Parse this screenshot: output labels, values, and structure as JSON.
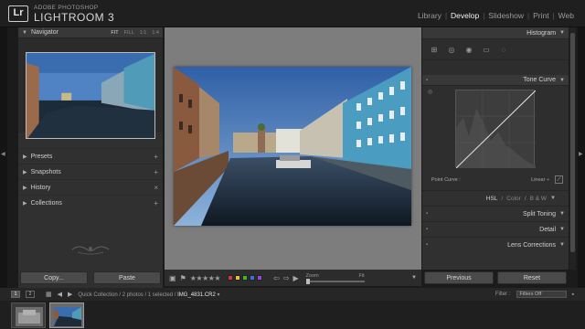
{
  "app": {
    "brand_small": "ADOBE PHOTOSHOP",
    "brand_main": "LIGHTROOM 3",
    "logo": "Lr"
  },
  "modules": [
    {
      "label": "Library"
    },
    {
      "label": "Develop",
      "active": true
    },
    {
      "label": "Slideshow"
    },
    {
      "label": "Print"
    },
    {
      "label": "Web"
    }
  ],
  "navigator": {
    "title": "Navigator",
    "options": [
      "FIT",
      "FILL",
      "1:1",
      "1:4"
    ]
  },
  "left_sections": [
    {
      "label": "Presets",
      "action": "+"
    },
    {
      "label": "Snapshots",
      "action": "+"
    },
    {
      "label": "History",
      "action": "×"
    },
    {
      "label": "Collections",
      "action": "+"
    }
  ],
  "left_buttons": {
    "copy": "Copy...",
    "paste": "Paste"
  },
  "toolbar": {
    "stars": "★★★★★",
    "color_labels": [
      "#d23a3a",
      "#e3c235",
      "#47b043",
      "#3d6fd8",
      "#8e4fc6"
    ],
    "zoom_label": "Zoom",
    "fit_label": "Fit"
  },
  "right_panel": {
    "histogram": "Histogram",
    "tone_curve": "Tone Curve",
    "point_curve": "Point Curve :",
    "point_curve_value": "Linear ÷",
    "hsl": {
      "hsl": "HSL",
      "color": "Color",
      "bw": "B & W",
      "sep1": "/",
      "sep2": "/"
    },
    "sections": [
      "Split Toning",
      "Detail",
      "Lens Corrections"
    ]
  },
  "right_buttons": {
    "previous": "Previous",
    "reset": "Reset"
  },
  "filmstrip": {
    "screen1": "1",
    "screen2": "2",
    "collection": "Quick Collection / 2 photos / 1 selected /",
    "filename": "IMG_4831.CR2",
    "filter_label": "Filter :",
    "filter_value": "Filters Off"
  }
}
